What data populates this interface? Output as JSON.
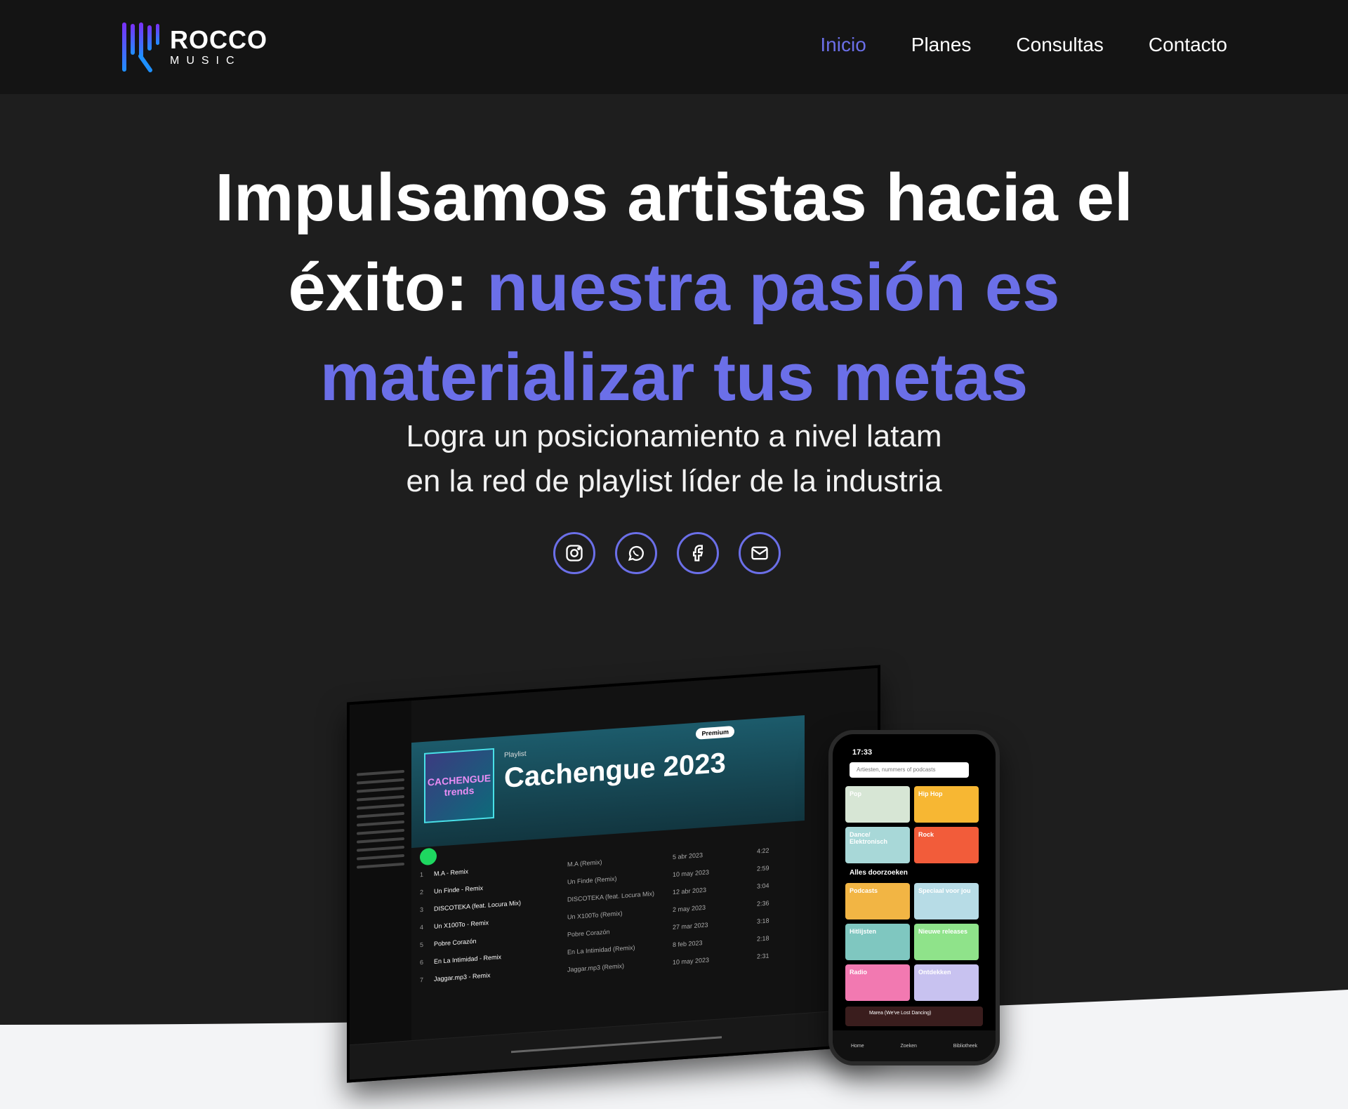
{
  "brand": {
    "name": "ROCCO",
    "sub": "MUSIC"
  },
  "nav": [
    {
      "label": "Inicio",
      "active": true
    },
    {
      "label": "Planes",
      "active": false
    },
    {
      "label": "Consultas",
      "active": false
    },
    {
      "label": "Contacto",
      "active": false
    }
  ],
  "hero": {
    "title_white_1": "Impulsamos artistas hacia el",
    "title_white_2": "éxito:",
    "title_accent_1": "nuestra pasión es",
    "title_accent_2": "materializar tus metas",
    "subtitle_line1": "Logra un posicionamiento a nivel latam",
    "subtitle_line2": "en la red de playlist líder de la industria"
  },
  "socials": [
    {
      "icon": "instagram-icon"
    },
    {
      "icon": "whatsapp-icon"
    },
    {
      "icon": "facebook-icon"
    },
    {
      "icon": "mail-icon"
    }
  ],
  "colors": {
    "accent": "#6b6fe8",
    "background": "#1e1e1e",
    "navbar": "#141414",
    "wave": "#f3f4f6"
  },
  "laptop": {
    "playlist_type": "Playlist",
    "playlist_title": "Cachengue 2023",
    "cover_text": "CACHENGUE trends",
    "premium_badge": "Premium",
    "tracks": [
      {
        "n": "1",
        "title": "M.A - Remix",
        "album": "M.A (Remix)",
        "date": "5 abr 2023",
        "len": "4:22"
      },
      {
        "n": "2",
        "title": "Un Finde - Remix",
        "album": "Un Finde (Remix)",
        "date": "10 may 2023",
        "len": "2:59"
      },
      {
        "n": "3",
        "title": "DISCOTEKA (feat. Locura Mix)",
        "album": "DISCOTEKA (feat. Locura Mix)",
        "date": "12 abr 2023",
        "len": "3:04"
      },
      {
        "n": "4",
        "title": "Un X100To - Remix",
        "album": "Un X100To (Remix)",
        "date": "2 may 2023",
        "len": "2:36"
      },
      {
        "n": "5",
        "title": "Pobre Corazón",
        "album": "Pobre Corazón",
        "date": "27 mar 2023",
        "len": "3:18"
      },
      {
        "n": "6",
        "title": "En La Intimidad - Remix",
        "album": "En La Intimidad (Remix)",
        "date": "8 feb 2023",
        "len": "2:18"
      },
      {
        "n": "7",
        "title": "Jaggar.mp3 - Remix",
        "album": "Jaggar.mp3 (Remix)",
        "date": "10 may 2023",
        "len": "2:31"
      }
    ]
  },
  "phone": {
    "time": "17:33",
    "search_placeholder": "Artiesten, nummers of podcasts",
    "tiles_top": [
      "Pop",
      "Hip Hop",
      "Dance/ Elektronisch",
      "Rock"
    ],
    "section": "Alles doorzoeken",
    "tiles_bottom": [
      "Podcasts",
      "Speciaal voor jou",
      "Hitlijsten",
      "Nieuwe releases",
      "Radio",
      "Ontdekken"
    ],
    "now_playing": "Marea (We've Lost Dancing)",
    "nav_items": [
      "Home",
      "Zoeken",
      "Bibliotheek"
    ]
  }
}
